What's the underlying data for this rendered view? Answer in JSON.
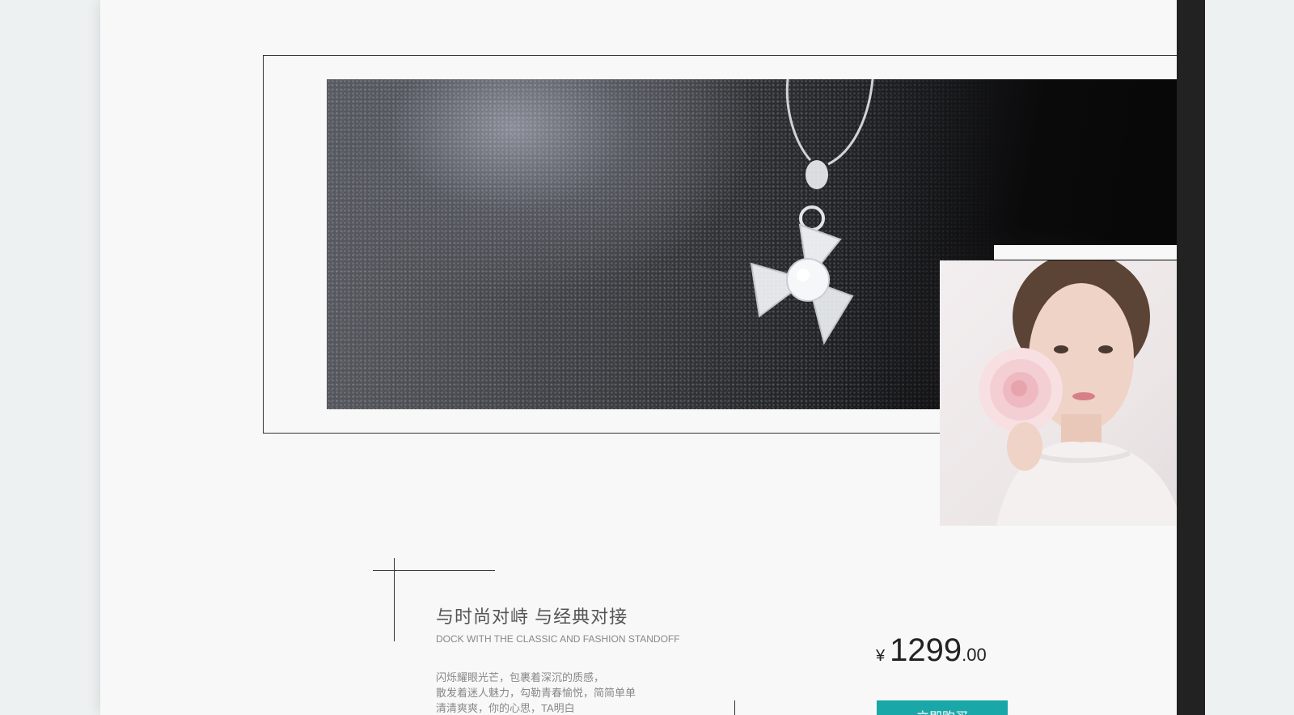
{
  "product": {
    "title_cn": "与时尚对峙 与经典对接",
    "title_en": "DOCK WITH THE CLASSIC AND FASHION STANDOFF",
    "description": [
      "闪烁耀眼光芒，包裹着深沉的质感，",
      "散发着迷人魅力，勾勒青春愉悦，简简单单",
      "清清爽爽，你的心思，TA明白"
    ]
  },
  "price": {
    "currency": "¥",
    "integer": "1299",
    "decimal": ".00"
  },
  "buy_button": {
    "label": "立即购买"
  },
  "colors": {
    "accent": "#1aa7a8",
    "page_bg": "#f8f8f8",
    "rail": "#222222"
  }
}
